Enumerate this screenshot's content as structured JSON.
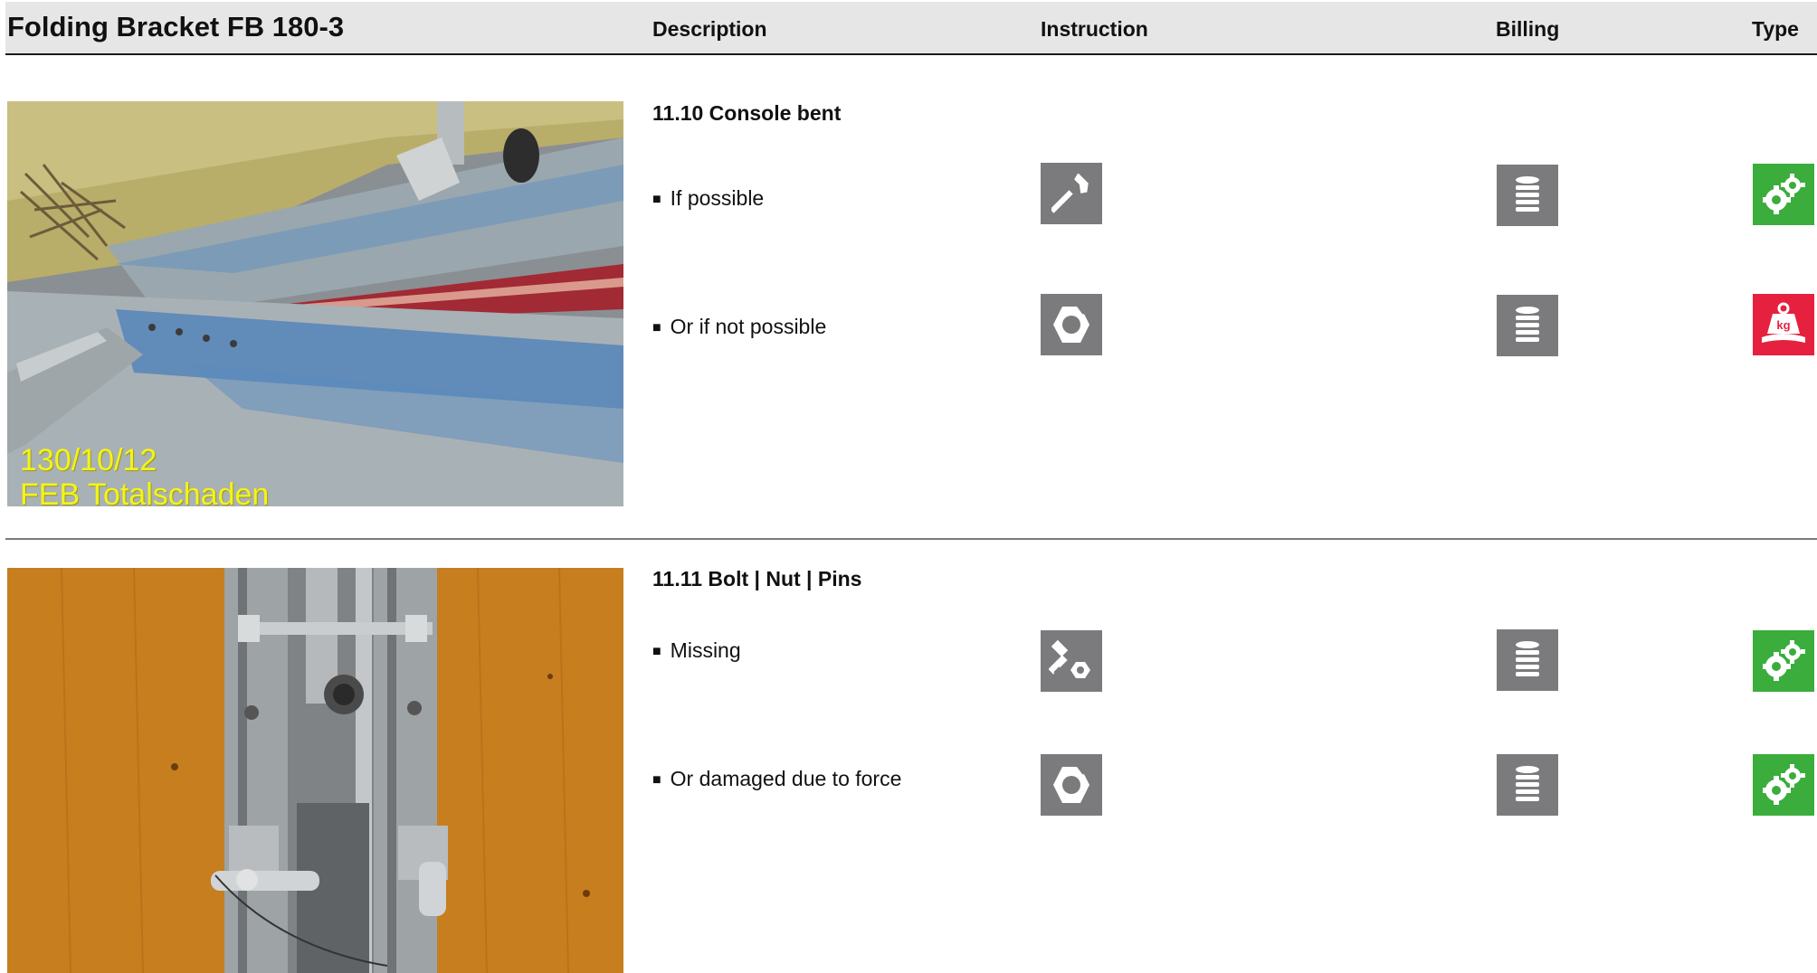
{
  "header": {
    "title": "Folding Bracket FB 180-3",
    "columns": {
      "description": "Description",
      "instruction": "Instruction",
      "billing": "Billing",
      "type": "Type"
    }
  },
  "sections": [
    {
      "title": "11.10 Console bent",
      "photo_caption": [
        "130/10/12",
        "FEB Totalschaden"
      ],
      "items": [
        {
          "label": "If possible",
          "instruction_icon": "hammer-icon",
          "billing_icon": "coin-stack-icon",
          "type_icon": "gears-icon",
          "type_color": "#3aad3c"
        },
        {
          "label": "Or if not possible",
          "instruction_icon": "broken-nut-icon",
          "billing_icon": "coin-stack-icon",
          "type_icon": "weight-kg-icon",
          "type_color": "#e5213f",
          "type_icon_text": "kg"
        }
      ]
    },
    {
      "title": "11.11 Bolt | Nut | Pins",
      "items": [
        {
          "label": "Missing",
          "instruction_icon": "bolt-nut-icon",
          "billing_icon": "coin-stack-icon",
          "type_icon": "gears-icon",
          "type_color": "#3aad3c"
        },
        {
          "label": "Or damaged due to force",
          "instruction_icon": "broken-nut-icon",
          "billing_icon": "coin-stack-icon",
          "type_icon": "gears-icon",
          "type_color": "#3aad3c"
        }
      ]
    }
  ],
  "colors": {
    "header_bg": "#e6e6e6",
    "icon_grey": "#7b7b7d",
    "type_green": "#3aad3c",
    "type_red": "#e5213f",
    "caption_yellow": "#f3f31b"
  }
}
